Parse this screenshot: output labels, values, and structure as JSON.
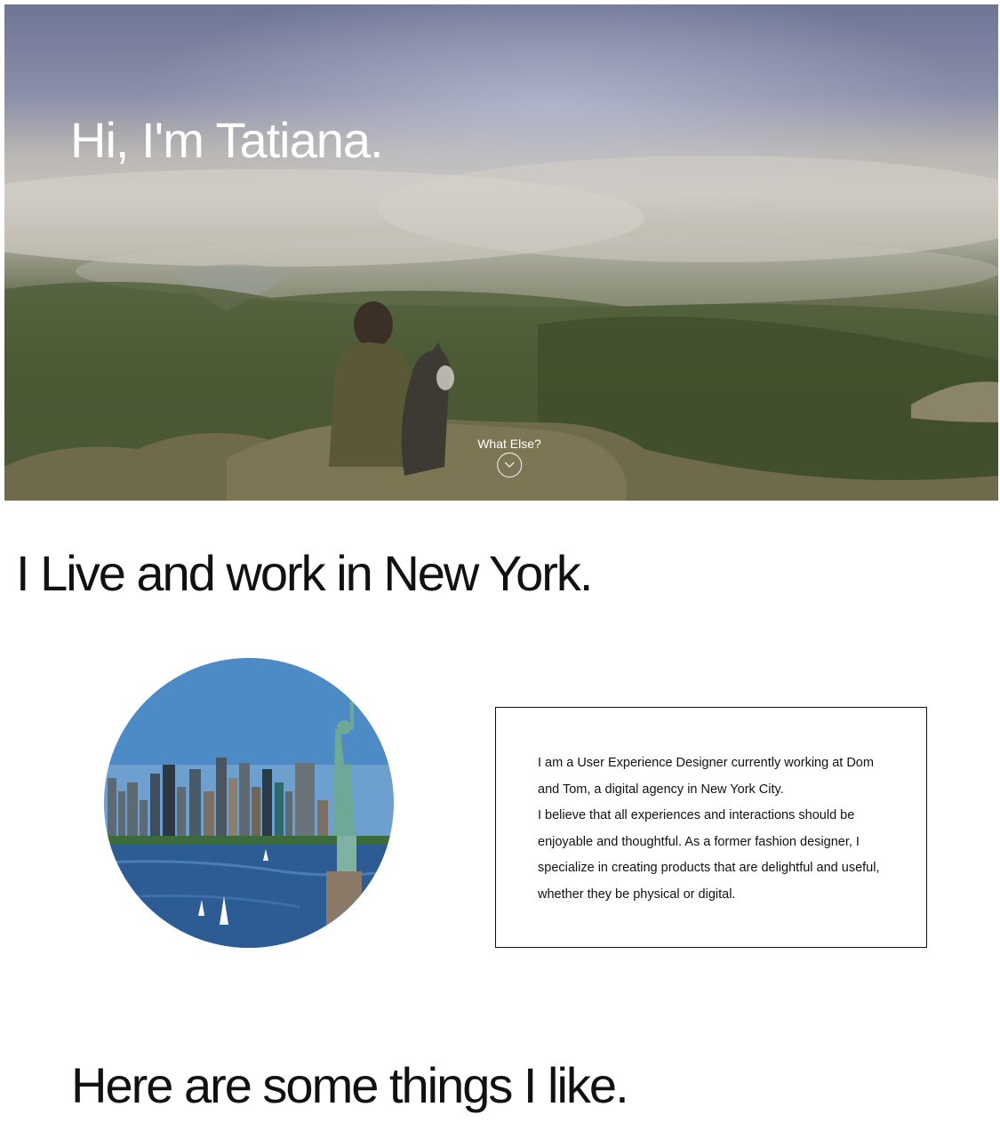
{
  "hero": {
    "title": "Hi, I'm Tatiana.",
    "cta_label": "What Else?",
    "cta_icon": "chevron-down-icon"
  },
  "location": {
    "heading": "I Live and work in New York."
  },
  "bio": {
    "lines": [
      "I am a User Experience Designer currently working at Dom and Tom, a digital agency in New York City.",
      "I believe that all experiences and interactions should be enjoyable and thoughtful. As a former fashion designer, I specialize in creating products that are delightful and useful, whether they be physical or digital."
    ]
  },
  "likes": {
    "heading": "Here are some things I like."
  }
}
